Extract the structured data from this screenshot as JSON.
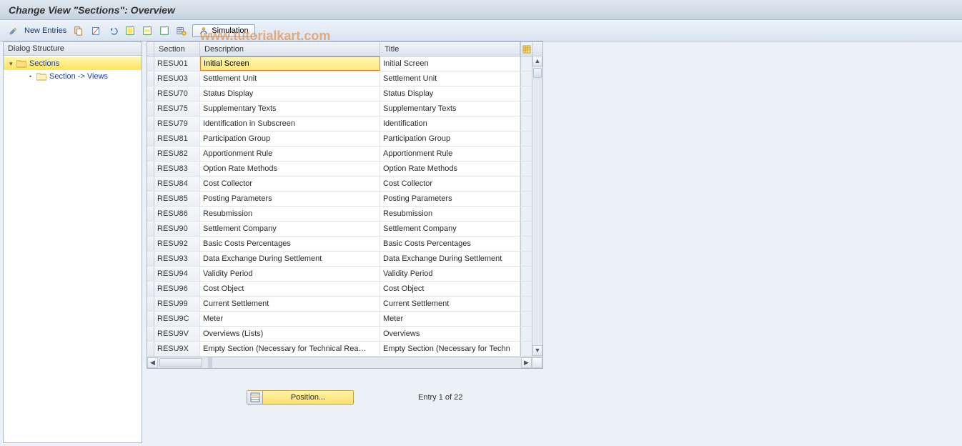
{
  "title": "Change View \"Sections\": Overview",
  "toolbar": {
    "new_entries_label": "New Entries",
    "simulation_label": "Simulation"
  },
  "watermark": "www.tutorialkart.com",
  "dialog_structure": {
    "header": "Dialog Structure",
    "items": [
      {
        "label": "Sections",
        "selected": true,
        "children": [
          {
            "label": "Section -> Views",
            "selected": false
          }
        ]
      }
    ]
  },
  "table": {
    "columns": {
      "section": "Section",
      "description": "Description",
      "title": "Title"
    },
    "rows": [
      {
        "section": "RESU01",
        "description": "Initial Screen",
        "title": "Initial Screen"
      },
      {
        "section": "RESU03",
        "description": "Settlement Unit",
        "title": "Settlement Unit"
      },
      {
        "section": "RESU70",
        "description": "Status Display",
        "title": "Status Display"
      },
      {
        "section": "RESU75",
        "description": "Supplementary Texts",
        "title": "Supplementary Texts"
      },
      {
        "section": "RESU79",
        "description": "Identification in Subscreen",
        "title": "Identification"
      },
      {
        "section": "RESU81",
        "description": "Participation Group",
        "title": "Participation Group"
      },
      {
        "section": "RESU82",
        "description": "Apportionment Rule",
        "title": "Apportionment Rule"
      },
      {
        "section": "RESU83",
        "description": "Option Rate Methods",
        "title": "Option Rate Methods"
      },
      {
        "section": "RESU84",
        "description": "Cost Collector",
        "title": "Cost Collector"
      },
      {
        "section": "RESU85",
        "description": "Posting Parameters",
        "title": "Posting Parameters"
      },
      {
        "section": "RESU86",
        "description": "Resubmission",
        "title": "Resubmission"
      },
      {
        "section": "RESU90",
        "description": "Settlement Company",
        "title": "Settlement Company"
      },
      {
        "section": "RESU92",
        "description": "Basic Costs Percentages",
        "title": "Basic Costs Percentages"
      },
      {
        "section": "RESU93",
        "description": "Data Exchange During Settlement",
        "title": "Data Exchange During Settlement"
      },
      {
        "section": "RESU94",
        "description": "Validity Period",
        "title": "Validity Period"
      },
      {
        "section": "RESU96",
        "description": "Cost Object",
        "title": "Cost Object"
      },
      {
        "section": "RESU99",
        "description": "Current Settlement",
        "title": "Current Settlement"
      },
      {
        "section": "RESU9C",
        "description": "Meter",
        "title": "Meter"
      },
      {
        "section": "RESU9V",
        "description": "Overviews (Lists)",
        "title": "Overviews"
      },
      {
        "section": "RESU9X",
        "description": "Empty Section (Necessary for Technical Rea…",
        "title": "Empty Section (Necessary for Techn"
      }
    ]
  },
  "footer": {
    "position_label": "Position...",
    "entry_text": "Entry 1 of 22"
  }
}
